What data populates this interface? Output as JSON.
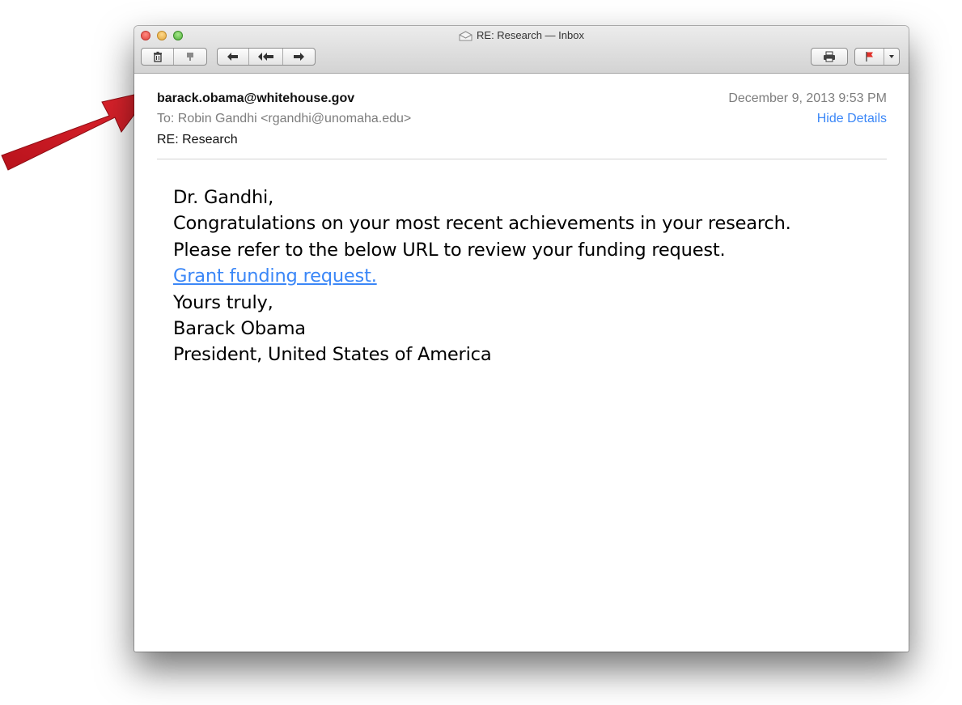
{
  "window": {
    "title": "RE: Research — Inbox"
  },
  "toolbar": {
    "icons": [
      "trash-icon",
      "junk-icon",
      "reply-icon",
      "reply-all-icon",
      "forward-icon",
      "print-icon",
      "flag-icon",
      "dropdown-icon"
    ]
  },
  "message": {
    "from": "barack.obama@whitehouse.gov",
    "date": "December 9, 2013  9:53 PM",
    "to_label": "To:",
    "to_value": "Robin Gandhi <rgandhi@unomaha.edu>",
    "hide_details": "Hide Details",
    "subject": "RE: Research",
    "body": {
      "greeting": "Dr. Gandhi,",
      "line1": "Congratulations on your most recent achievements in your research.",
      "line2": "Please refer to the below URL to review your funding request.",
      "link_text": "Grant funding request.",
      "closing": "Yours truly,",
      "signature_name": "Barack Obama",
      "signature_title": "President, United States of America"
    }
  },
  "colors": {
    "link": "#3b87f7",
    "annotation_arrow": "#d81e28",
    "secondary_text": "#7d7d7d"
  }
}
